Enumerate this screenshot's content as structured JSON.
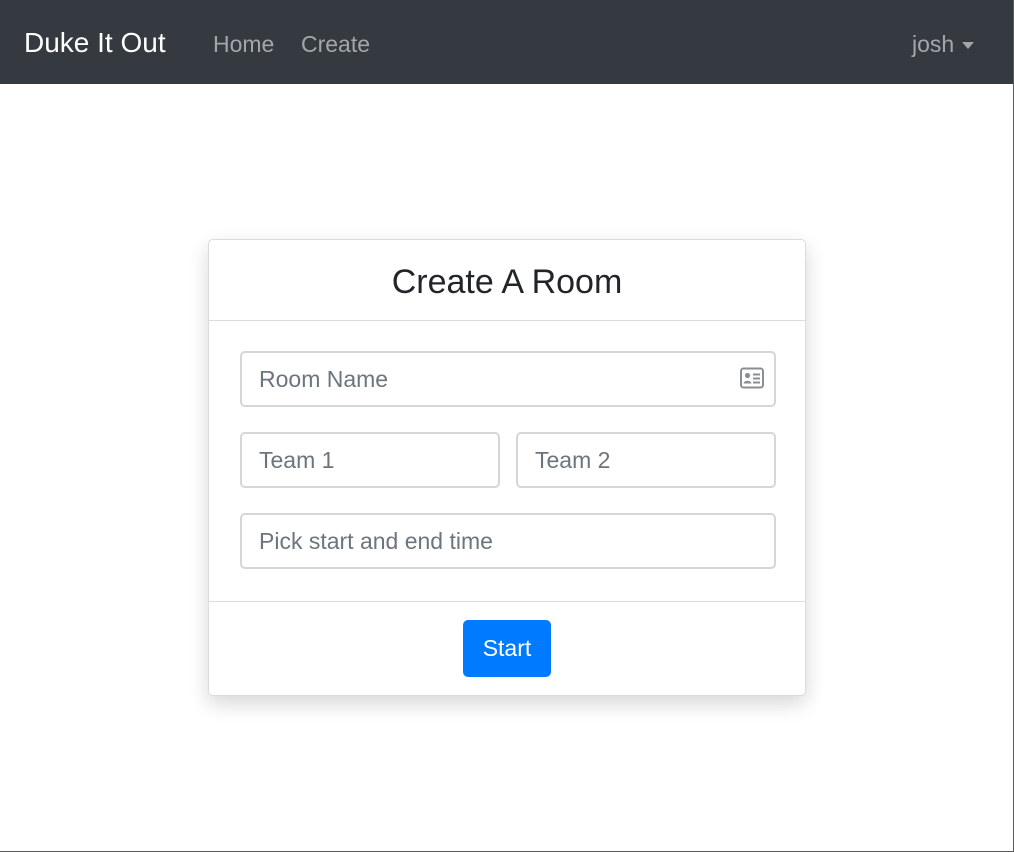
{
  "navbar": {
    "brand": "Duke It Out",
    "links": [
      {
        "label": "Home"
      },
      {
        "label": "Create"
      }
    ],
    "user": "josh"
  },
  "card": {
    "title": "Create A Room",
    "room_name_placeholder": "Room Name",
    "room_name_icon": "id-card-icon",
    "team1_placeholder": "Team 1",
    "team2_placeholder": "Team 2",
    "time_placeholder": "Pick start and end time",
    "start_label": "Start"
  },
  "colors": {
    "navbar_bg": "#343a40",
    "primary": "#007bff",
    "nav_link": "rgba(255,255,255,0.55)"
  }
}
